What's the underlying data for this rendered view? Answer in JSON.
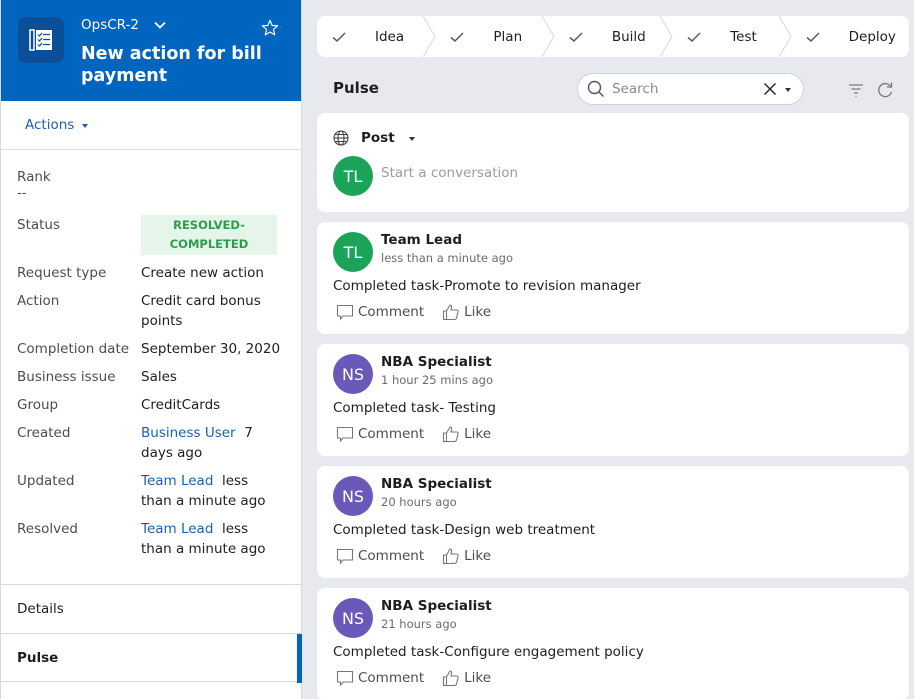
{
  "case": {
    "id": "OpsCR-2",
    "title": "New action for bill payment",
    "actions_label": "Actions"
  },
  "details": {
    "rank_label": "Rank",
    "rank_value": "--",
    "fields": [
      {
        "label": "Status",
        "value": "RESOLVED-COMPLETED"
      },
      {
        "label": "Request type",
        "value": "Create new action"
      },
      {
        "label": "Action",
        "value": "Credit card bonus points"
      },
      {
        "label": "Completion date",
        "value": "September 30, 2020"
      },
      {
        "label": "Business issue",
        "value": "Sales"
      },
      {
        "label": "Group",
        "value": "CreditCards"
      },
      {
        "label": "Created",
        "link": "Business User",
        "value": "7 days ago"
      },
      {
        "label": "Updated",
        "link": "Team Lead",
        "value": "less than a minute ago"
      },
      {
        "label": "Resolved",
        "link": "Team Lead",
        "value": "less than a minute ago"
      }
    ],
    "status_line1": "RESOLVED-",
    "status_line2": "COMPLETED"
  },
  "left_tabs": [
    {
      "label": "Details",
      "active": false
    },
    {
      "label": "Pulse",
      "active": true
    }
  ],
  "stages": [
    {
      "label": "Idea",
      "icon": "check-icon"
    },
    {
      "label": "Plan",
      "icon": "check-icon"
    },
    {
      "label": "Build",
      "icon": "check-icon"
    },
    {
      "label": "Test",
      "icon": "check-icon"
    },
    {
      "label": "Deploy",
      "icon": "check-icon"
    }
  ],
  "pulse": {
    "title": "Pulse",
    "search_placeholder": "Search",
    "composer": {
      "post_label": "Post",
      "avatar_initials": "TL",
      "placeholder": "Start a conversation"
    },
    "comment_label": "Comment",
    "like_label": "Like",
    "feed": [
      {
        "author": "Team Lead",
        "initials": "TL",
        "color": "#1ba35a",
        "time": "less than a minute ago",
        "message": "Completed task-Promote to revision manager"
      },
      {
        "author": "NBA Specialist",
        "initials": "NS",
        "color": "#6a59b8",
        "time": "1 hour 25 mins ago",
        "message": "Completed task- Testing"
      },
      {
        "author": "NBA Specialist",
        "initials": "NS",
        "color": "#6a59b8",
        "time": "20 hours ago",
        "message": "Completed task-Design web treatment"
      },
      {
        "author": "NBA Specialist",
        "initials": "NS",
        "color": "#6a59b8",
        "time": "21 hours ago",
        "message": "Completed task-Configure engagement policy"
      }
    ]
  },
  "colors": {
    "header_blue": "#0065bf",
    "link_blue": "#1f5fa8",
    "status_green": "#2e9c4e",
    "status_bg": "#e5f5e9"
  }
}
